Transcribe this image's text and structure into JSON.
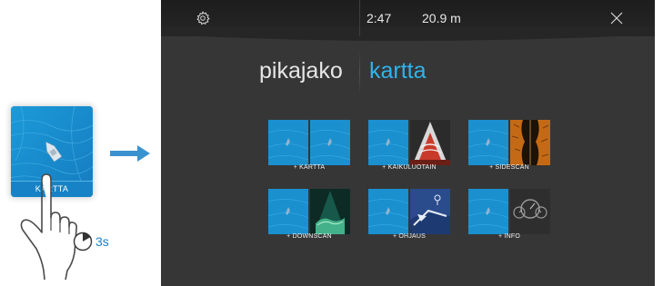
{
  "home_tile": {
    "label": "KARTTA"
  },
  "gesture": {
    "hold_time": "3s"
  },
  "topbar": {
    "time": "2:47",
    "depth": "20.9 m"
  },
  "header": {
    "left_title": "pikajako",
    "right_title": "kartta"
  },
  "options": [
    {
      "label": "+ KARTTA",
      "right_pane": "chart"
    },
    {
      "label": "+ KAIKULUOTAIN",
      "right_pane": "sonar"
    },
    {
      "label": "+ SIDESCAN",
      "right_pane": "sidescan"
    },
    {
      "label": "+ DOWNSCAN",
      "right_pane": "downscan"
    },
    {
      "label": "+ OHJAUS",
      "right_pane": "steering"
    },
    {
      "label": "+ INFO",
      "right_pane": "info"
    }
  ],
  "colors": {
    "accent": "#2fb4ee",
    "screen_bg": "#363636",
    "chart_blue": "#1a90cf"
  }
}
